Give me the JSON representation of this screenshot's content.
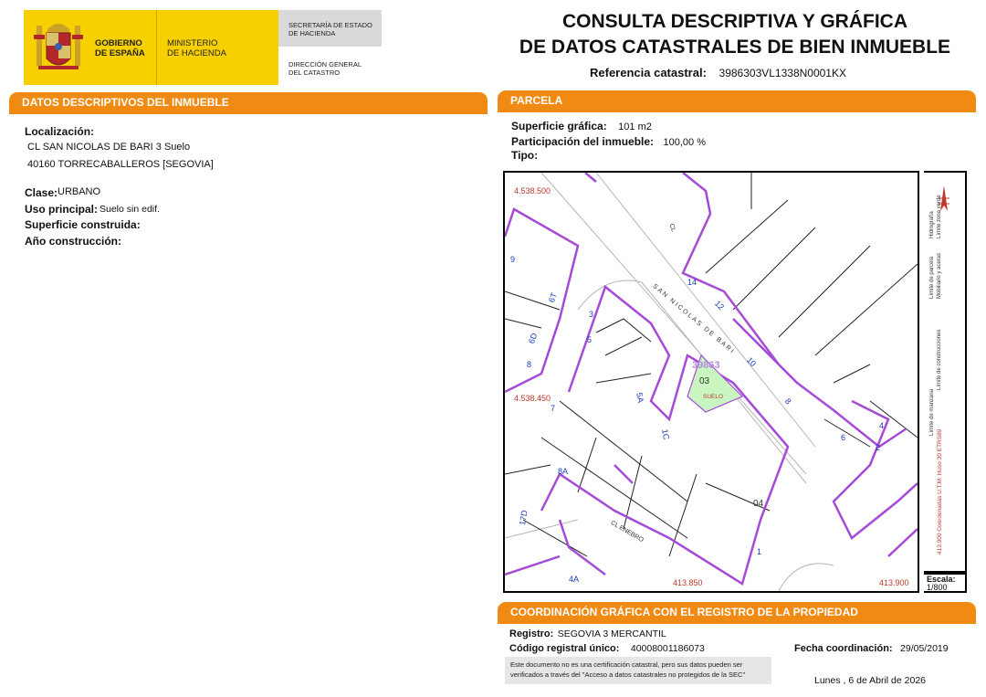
{
  "header": {
    "gobierno": [
      "GOBIERNO",
      "DE ESPAÑA"
    ],
    "ministerio": [
      "MINISTERIO",
      "DE HACIENDA"
    ],
    "secretaria": [
      "SECRETARÍA DE ESTADO",
      "DE HACIENDA"
    ],
    "direccion": [
      "DIRECCIÓN GENERAL",
      "DEL CATASTRO"
    ],
    "title_line1": "CONSULTA DESCRIPTIVA Y GRÁFICA",
    "title_line2": "DE DATOS CATASTRALES DE BIEN INMUEBLE",
    "ref_label": "Referencia catastral:",
    "ref_value": "3986303VL1338N0001KX"
  },
  "datos": {
    "band": "DATOS DESCRIPTIVOS DEL INMUEBLE",
    "localizacion_label": "Localización:",
    "address1": "CL SAN NICOLAS DE BARI 3 Suelo",
    "address2": "40160 TORRECABALLEROS [SEGOVIA]",
    "clase_label": "Clase:",
    "clase_value": "URBANO",
    "uso_label": "Uso principal:",
    "uso_value": "Suelo sin edif.",
    "superficie_label": "Superficie construida:",
    "anio_label": "Año construcción:"
  },
  "parcela": {
    "band": "PARCELA",
    "superficie_label": "Superficie gráfica:",
    "superficie_value": "101 m2",
    "participacion_label": "Participación del inmueble:",
    "participacion_value": "100,00 %",
    "tipo_label": "Tipo:"
  },
  "map": {
    "y_top": "4.538.500",
    "y_mid": "4.538.450",
    "x_left": "413.850",
    "x_right": "413.900",
    "parcel_ref": "39863",
    "parcel_no": "03",
    "parcel_kind": "SUELO",
    "street1": "SAN NICOLAS DE BARI",
    "street_cl": "CL",
    "street2": "CL ENEBRO",
    "n_14": "14",
    "n_12": "12",
    "n_10": "10",
    "n_8": "8",
    "n_6": "6",
    "n_4": "4",
    "n_2": "2",
    "n_3": "3",
    "n_5": "5",
    "n_5a": "5A",
    "n_7": "7",
    "n_8b": "8",
    "n_9": "9",
    "n_1c": "1C",
    "n_1": "1",
    "n_04": "04",
    "n_6t": "6T",
    "n_8a": "8A",
    "n_17d": "17D",
    "n_4a": "4A",
    "n_6d": "6D"
  },
  "legend": {
    "items": [
      "Límite de manzana",
      "Límite de parcela",
      "Límite de construcciones",
      "Mobiliario y aceras",
      "Límite zona verde",
      "Hidrografía"
    ],
    "coords": "413.900 Coordenadas U.T.M. Huso 30 ETRS89",
    "escala_label": "Escala:",
    "escala_value": "1/800"
  },
  "coord": {
    "band": "COORDINACIÓN GRÁFICA CON EL REGISTRO DE LA PROPIEDAD",
    "registro_label": "Registro:",
    "registro_value": "SEGOVIA 3 MERCANTIL",
    "codigo_label": "Código registral único:",
    "codigo_value": "40008001186073",
    "fecha_label": "Fecha coordinación:",
    "fecha_value": "29/05/2019",
    "note": "Este documento no es una certificación catastral, pero sus datos pueden ser verificados a través del \"Acceso a datos catastrales no protegidos de la SEC\"",
    "date": "Lunes , 6 de Abril de 2026"
  },
  "colors": {
    "orange": "#f08a12",
    "yellow": "#f8d000",
    "purple": "#a64ad8",
    "green": "#c8f5c0",
    "red": "#c0392b",
    "blue": "#1a3db8"
  }
}
